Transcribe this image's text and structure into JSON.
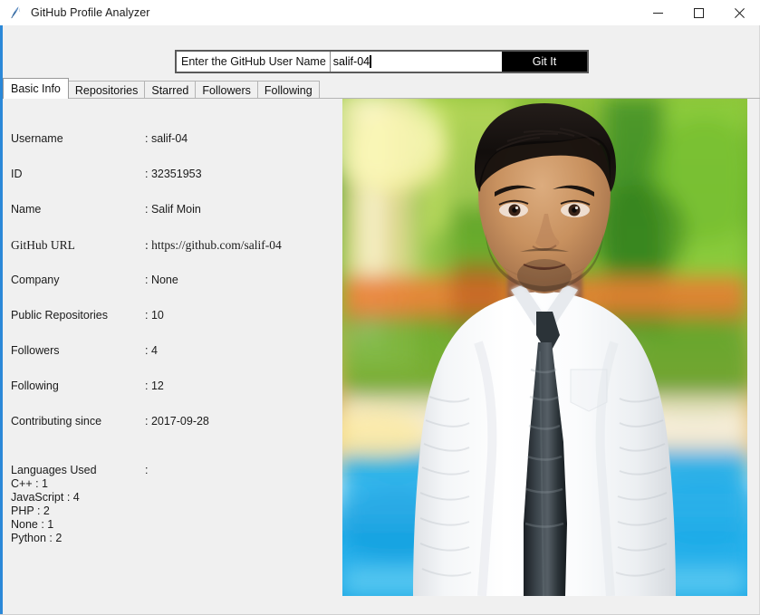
{
  "window": {
    "title": "GitHub Profile Analyzer",
    "icon": "python-feather-icon",
    "controls": {
      "minimize": "minimize-icon",
      "maximize": "maximize-icon",
      "close": "close-icon"
    }
  },
  "search": {
    "label": "Enter the GitHub User Name",
    "value": "salif-04",
    "placeholder": "",
    "button_label": "Git It"
  },
  "tabs": [
    {
      "label": "Basic Info",
      "active": true
    },
    {
      "label": "Repositories",
      "active": false
    },
    {
      "label": "Starred",
      "active": false
    },
    {
      "label": "Followers",
      "active": false
    },
    {
      "label": "Following",
      "active": false
    }
  ],
  "basic_info": {
    "rows": [
      {
        "key": "Username",
        "value": ": salif-04",
        "serif": false
      },
      {
        "key": "ID",
        "value": ": 32351953",
        "serif": false
      },
      {
        "key": "Name",
        "value": ": Salif Moin",
        "serif": false
      },
      {
        "key": "GitHub URL",
        "value": ": https://github.com/salif-04",
        "serif": true
      },
      {
        "key": "Company",
        "value": ": None",
        "serif": false
      },
      {
        "key": "Public Repositories",
        "value": ": 10",
        "serif": false
      },
      {
        "key": "Followers",
        "value": ": 4",
        "serif": false
      },
      {
        "key": "Following",
        "value": ": 12",
        "serif": false
      },
      {
        "key": "Contributing since",
        "value": ": 2017-09-28",
        "serif": false
      }
    ],
    "languages": {
      "key": "Languages Used",
      "separator": ":",
      "lines": [
        "C++ : 1",
        "JavaScript : 4",
        "PHP : 2",
        "None : 1",
        "Python : 2"
      ]
    }
  },
  "avatar": {
    "name": "profile-photo",
    "description": "Photograph of a man in a white shirt with a dark tie standing in front of green foliage and a blue swimming pool"
  },
  "colors": {
    "accent_blue": "#2b88d8",
    "button_bg": "#000000",
    "button_fg": "#ffffff",
    "client_bg": "#f0f0f0",
    "tab_active_bg": "#ffffff",
    "text": "#1b1b1b"
  }
}
